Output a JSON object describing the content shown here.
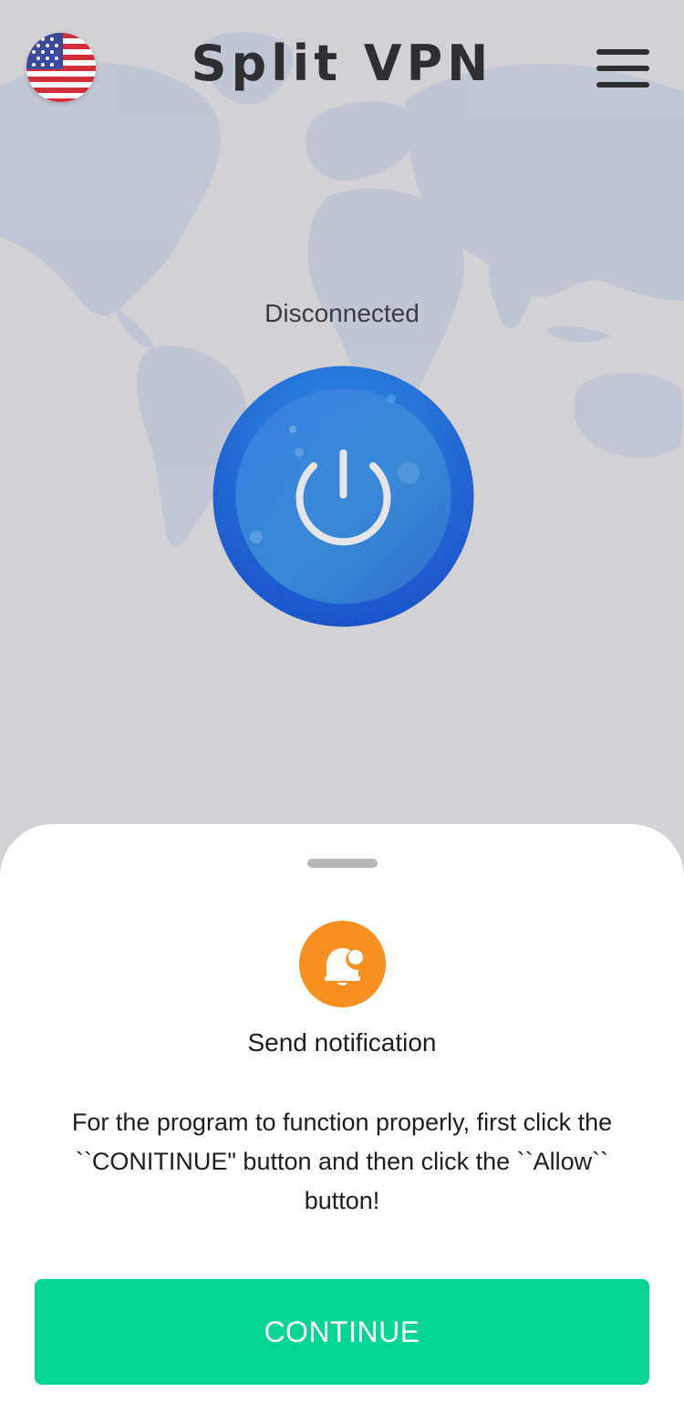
{
  "header": {
    "title": "Split VPN",
    "flag_icon": "us-flag-icon",
    "menu_icon": "hamburger-menu-icon"
  },
  "main": {
    "status": "Disconnected",
    "power_icon": "power-icon"
  },
  "sheet": {
    "icon": "notification-bell-icon",
    "title": "Send notification",
    "message": "For the program to function properly, first click the ``CONITINUE\" button and then click the ``Allow`` button!",
    "continue_label": "CONTINUE"
  },
  "colors": {
    "accent_green": "#05d593",
    "power_blue": "#1e6fd9",
    "bell_orange": "#f7901e",
    "overlay_gray": "#d2d2d4"
  }
}
